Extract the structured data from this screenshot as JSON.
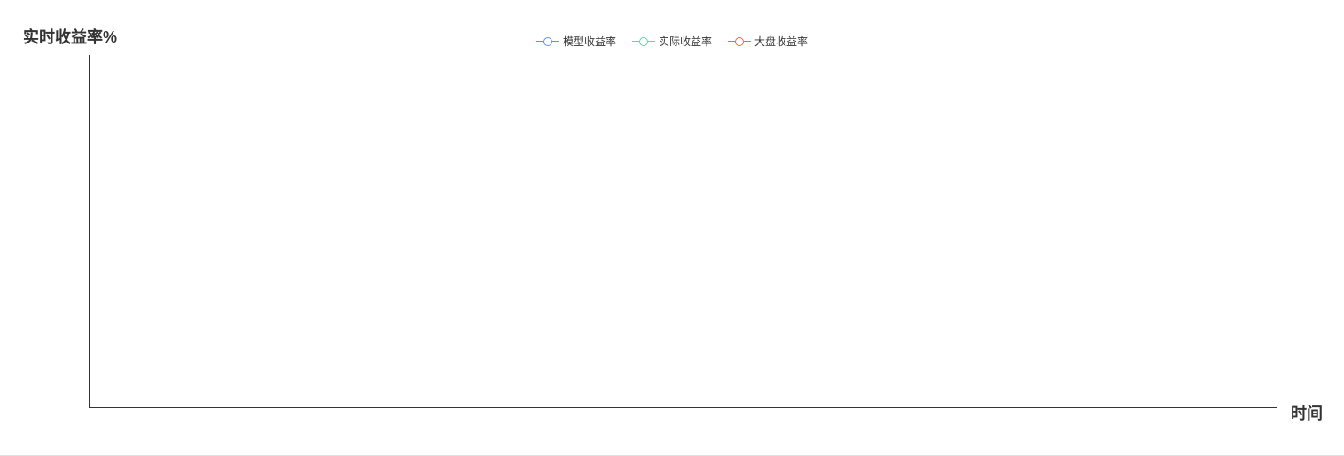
{
  "chart_data": {
    "type": "line",
    "title": "",
    "ylabel": "实时收益率%",
    "xlabel": "时间",
    "x": [],
    "series": [
      {
        "name": "模型收益率",
        "color": "#5b8ff9",
        "values": []
      },
      {
        "name": "实际收益率",
        "color": "#5ad8a6",
        "values": []
      },
      {
        "name": "大盘收益率",
        "color": "#e8684a",
        "values": []
      }
    ],
    "legend_position": "top-center",
    "grid": false
  },
  "legend": {
    "items": [
      {
        "label": "模型收益率",
        "color": "#5b8ff9"
      },
      {
        "label": "实际收益率",
        "color": "#5ad8a6"
      },
      {
        "label": "大盘收益率",
        "color": "#e8684a"
      }
    ]
  },
  "axes": {
    "y_title": "实时收益率%",
    "x_title": "时间"
  }
}
